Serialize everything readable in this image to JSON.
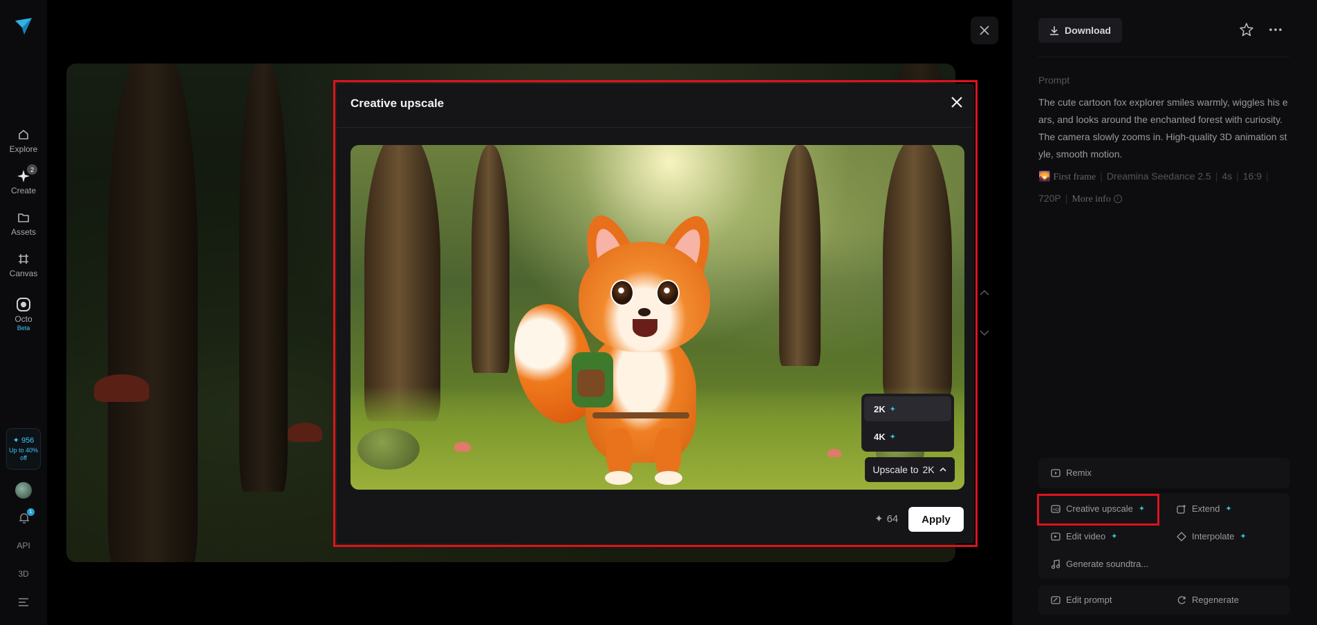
{
  "sidebar": {
    "items": [
      {
        "label": "Explore",
        "icon": "home-icon"
      },
      {
        "label": "Create",
        "icon": "sparkle-icon",
        "badge": "2"
      },
      {
        "label": "Assets",
        "icon": "folder-icon"
      },
      {
        "label": "Canvas",
        "icon": "canvas-icon"
      },
      {
        "label": "Octo",
        "icon": "octo-icon",
        "tag": "Beta"
      }
    ],
    "credits": "✦ 956",
    "credits_promo": "Up to 40% off",
    "notification_count": "1",
    "api_label": "API",
    "three_d_label": "3D"
  },
  "right_panel": {
    "download_label": "Download",
    "prompt_heading": "Prompt",
    "prompt_text": "The cute cartoon fox explorer smiles warmly, wiggles his ears, and looks around the enchanted forest with curiosity. The camera slowly zooms in. High-quality 3D animation style, smooth motion.",
    "meta": {
      "first_frame": "First frame",
      "model": "Dreamina Seedance 2.5",
      "duration": "4s",
      "ratio": "16:9",
      "resolution": "720P",
      "more_info": "More info"
    },
    "actions": {
      "remix": "Remix",
      "creative_upscale": "Creative upscale",
      "extend": "Extend",
      "edit_video": "Edit video",
      "interpolate": "Interpolate",
      "generate_soundtrack": "Generate soundtra...",
      "edit_prompt": "Edit prompt",
      "regenerate": "Regenerate"
    }
  },
  "modal": {
    "title": "Creative upscale",
    "resolution_options": [
      "2K",
      "4K"
    ],
    "selected_option": "2K",
    "upscale_prefix": "Upscale to",
    "upscale_value": "2K",
    "cost": "64",
    "apply_label": "Apply"
  },
  "colors": {
    "accent": "#3fc7ff",
    "spark": "#2fc6d0",
    "highlight": "#e0121f"
  }
}
